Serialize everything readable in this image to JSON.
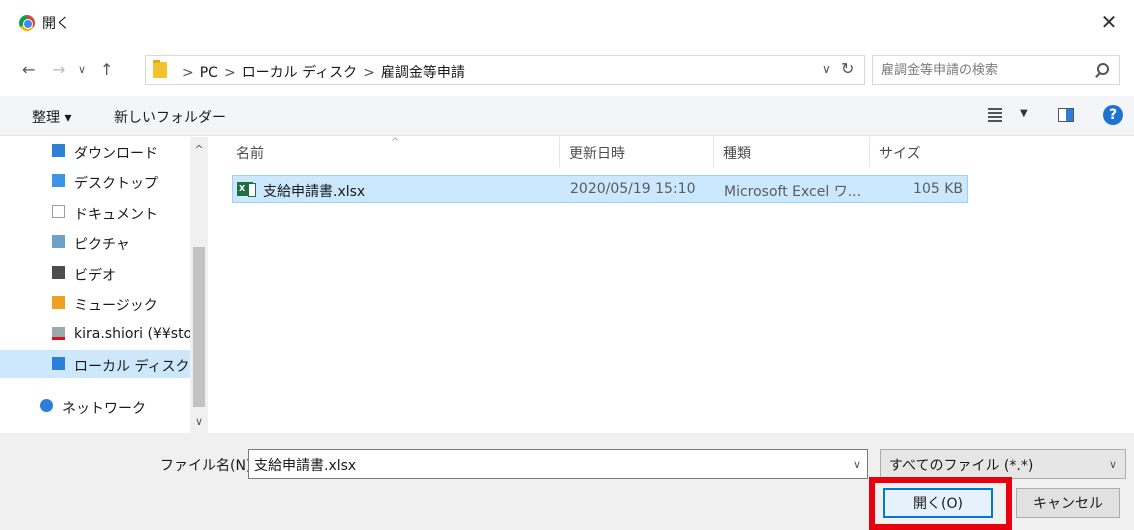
{
  "window": {
    "title": "開く"
  },
  "addressbar": {
    "breadcrumbs": [
      "PC",
      "ローカル ディスク",
      "雇調金等申請"
    ],
    "search_placeholder": "雇調金等申請の検索"
  },
  "toolbar": {
    "organize_label": "整理 ▾",
    "new_folder_label": "新しいフォルダー"
  },
  "sidebar": {
    "items": [
      {
        "label": "ダウンロード",
        "icon": "download-folder-icon",
        "color": "#2f7fd6"
      },
      {
        "label": "デスクトップ",
        "icon": "desktop-folder-icon",
        "color": "#3b95e3"
      },
      {
        "label": "ドキュメント",
        "icon": "documents-folder-icon",
        "color": "#8aa0b4"
      },
      {
        "label": "ピクチャ",
        "icon": "pictures-folder-icon",
        "color": "#6ea1c9"
      },
      {
        "label": "ビデオ",
        "icon": "videos-folder-icon",
        "color": "#4d4d4d"
      },
      {
        "label": "ミュージック",
        "icon": "music-folder-icon",
        "color": "#f0a020"
      },
      {
        "label": "kira.shiori (¥¥sto",
        "icon": "network-drive-disconnected-icon",
        "color": "#d11"
      },
      {
        "label": "ローカル ディスク",
        "icon": "local-disk-icon",
        "color": "#2b7fd6"
      },
      {
        "label": "ネットワーク",
        "icon": "network-icon",
        "color": "#2b7fd6"
      }
    ]
  },
  "filelist": {
    "columns": [
      "名前",
      "更新日時",
      "種類",
      "サイズ"
    ],
    "rows": [
      {
        "name": "支給申請書.xlsx",
        "modified": "2020/05/19 15:10",
        "type": "Microsoft Excel ワ...",
        "size": "105 KB"
      }
    ]
  },
  "footer": {
    "filename_label": "ファイル名(N):",
    "filename_value": "支給申請書.xlsx",
    "filetype_value": "すべてのファイル (*.*)",
    "open_label": "開く(O)",
    "cancel_label": "キャンセル"
  },
  "colors": {
    "accent": "#0078d7",
    "highlight": "#e8000d",
    "selection": "#cce8ff"
  }
}
